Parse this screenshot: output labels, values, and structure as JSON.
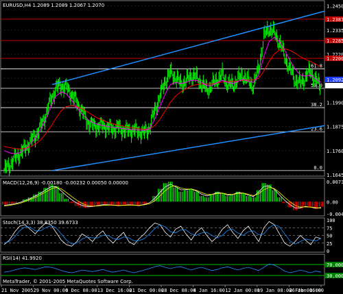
{
  "chart_data": {
    "type": "line",
    "main": {
      "title": "EURUSD,H4  1.2089 1.2089 1.2067 1.2070",
      "price_ticks": [
        "1.2450",
        "1.2335",
        "1.2220",
        "1.2105",
        "1.1990",
        "1.1875",
        "1.1760",
        "1.1645"
      ],
      "ylim": [
        1.1645,
        1.2465
      ],
      "last_price": "1.2070",
      "ask_tag": "1.2092",
      "fib_levels": [
        {
          "label": "0.0",
          "price": 1.1665
        },
        {
          "label": "23.6",
          "price": 1.185
        },
        {
          "label": "38.2",
          "price": 1.1965
        },
        {
          "label": "50.0",
          "price": 1.2057
        },
        {
          "label": "61.8",
          "price": 1.215
        }
      ],
      "red_lines": [
        1.22,
        1.2285,
        1.2387
      ],
      "price_series": [
        1.1665,
        1.169,
        1.172,
        1.1745,
        1.177,
        1.18,
        1.183,
        1.187,
        1.193,
        1.2,
        1.206,
        1.207,
        1.206,
        1.203,
        1.199,
        1.195,
        1.19,
        1.188,
        1.1875,
        1.188,
        1.187,
        1.1865,
        1.187,
        1.186,
        1.1855,
        1.186,
        1.185,
        1.1845,
        1.187,
        1.195,
        1.202,
        1.209,
        1.213,
        1.211,
        1.208,
        1.209,
        1.212,
        1.211,
        1.208,
        1.205,
        1.207,
        1.21,
        1.212,
        1.208,
        1.207,
        1.21,
        1.212,
        1.209,
        1.207,
        1.215,
        1.23,
        1.2345,
        1.232,
        1.228,
        1.221,
        1.215,
        1.21,
        1.208,
        1.211,
        1.214,
        1.209,
        1.207
      ],
      "ma_fast": [
        1.176,
        1.175,
        1.1745,
        1.175,
        1.1765,
        1.179,
        1.182,
        1.186,
        1.191,
        1.197,
        1.202,
        1.204,
        1.203,
        1.2,
        1.1965,
        1.1935,
        1.191,
        1.1895,
        1.1885,
        1.188,
        1.1875,
        1.187,
        1.1868,
        1.1865,
        1.1862,
        1.186,
        1.1858,
        1.1856,
        1.1865,
        1.191,
        1.197,
        1.203,
        1.2075,
        1.2085,
        1.208,
        1.2085,
        1.2095,
        1.2095,
        1.2085,
        1.207,
        1.207,
        1.2085,
        1.2095,
        1.2085,
        1.208,
        1.209,
        1.21,
        1.209,
        1.2085,
        1.212,
        1.221,
        1.228,
        1.23,
        1.228,
        1.224,
        1.219,
        1.215,
        1.212,
        1.2115,
        1.212,
        1.21,
        1.2085
      ],
      "ma_slow": [
        1.178,
        1.1775,
        1.177,
        1.1768,
        1.177,
        1.1778,
        1.179,
        1.181,
        1.184,
        1.1875,
        1.1915,
        1.195,
        1.197,
        1.1975,
        1.197,
        1.196,
        1.1945,
        1.193,
        1.1915,
        1.1905,
        1.1895,
        1.1888,
        1.1882,
        1.1876,
        1.1871,
        1.1868,
        1.1865,
        1.1862,
        1.1864,
        1.188,
        1.191,
        1.195,
        1.199,
        1.202,
        1.204,
        1.2055,
        1.2068,
        1.2075,
        1.2078,
        1.2078,
        1.2078,
        1.2082,
        1.2088,
        1.209,
        1.209,
        1.2092,
        1.2096,
        1.2097,
        1.2096,
        1.2105,
        1.214,
        1.2185,
        1.222,
        1.224,
        1.2245,
        1.2238,
        1.2225,
        1.2208,
        1.2195,
        1.2185,
        1.2172,
        1.216
      ]
    },
    "macd": {
      "title": "MACD(12,26,9) -0.00180 -0.00232 0.00050 0.00000",
      "ticks": [
        "0.00739",
        "0.00",
        "-0.00432"
      ],
      "ylim": [
        -0.0045,
        0.0075
      ],
      "histogram": [
        -0.001,
        -0.0008,
        -0.0005,
        0.0,
        0.0008,
        0.0015,
        0.0025,
        0.0035,
        0.0048,
        0.006,
        0.0055,
        0.003,
        0.001,
        -0.0005,
        -0.0015,
        -0.002,
        -0.0022,
        -0.0018,
        -0.0012,
        -0.0008,
        -0.001,
        -0.0012,
        -0.0015,
        -0.0012,
        -0.001,
        -0.0012,
        -0.0015,
        -0.0008,
        0.0,
        0.002,
        0.0045,
        0.0065,
        0.007,
        0.005,
        0.0035,
        0.004,
        0.0045,
        0.0035,
        0.002,
        0.0015,
        0.0025,
        0.0035,
        0.003,
        0.002,
        0.0025,
        0.0035,
        0.003,
        0.002,
        0.0015,
        0.004,
        0.0065,
        0.006,
        0.004,
        0.0015,
        -0.0005,
        -0.002,
        -0.003,
        -0.0025,
        -0.0015,
        -0.002,
        -0.0025,
        -0.0018
      ],
      "signal": [
        -0.0015,
        -0.0013,
        -0.001,
        -0.0006,
        0.0,
        0.0007,
        0.0015,
        0.0024,
        0.0034,
        0.0044,
        0.005,
        0.0045,
        0.0032,
        0.0018,
        0.0005,
        -0.0006,
        -0.0013,
        -0.0016,
        -0.0015,
        -0.0013,
        -0.0012,
        -0.0012,
        -0.0013,
        -0.0013,
        -0.0012,
        -0.0012,
        -0.0013,
        -0.0011,
        -0.0007,
        0.0003,
        0.002,
        0.0038,
        0.0052,
        0.0055,
        0.0048,
        0.0044,
        0.0044,
        0.004,
        0.0032,
        0.0025,
        0.0025,
        0.0029,
        0.003,
        0.0026,
        0.0025,
        0.0029,
        0.003,
        0.0026,
        0.0021,
        0.0028,
        0.0042,
        0.005,
        0.0046,
        0.0032,
        0.0015,
        0.0,
        -0.0013,
        -0.0019,
        -0.0018,
        -0.0019,
        -0.0021,
        -0.0023
      ]
    },
    "stoch": {
      "title": "Stoch(14,3,3) 38.8350 39.6733",
      "ticks": [
        "100",
        "75",
        "50",
        "25",
        "0"
      ],
      "ylim": [
        0,
        100
      ],
      "main": [
        20,
        35,
        60,
        80,
        85,
        70,
        55,
        75,
        90,
        85,
        60,
        35,
        20,
        15,
        30,
        55,
        45,
        30,
        50,
        65,
        40,
        25,
        45,
        60,
        30,
        20,
        40,
        55,
        75,
        90,
        85,
        60,
        45,
        70,
        80,
        55,
        35,
        60,
        75,
        50,
        30,
        45,
        70,
        85,
        60,
        40,
        65,
        80,
        55,
        30,
        75,
        95,
        85,
        55,
        25,
        15,
        30,
        50,
        35,
        20,
        45,
        39
      ],
      "signal": [
        25,
        30,
        45,
        65,
        78,
        77,
        65,
        65,
        75,
        82,
        75,
        55,
        35,
        22,
        25,
        38,
        45,
        42,
        42,
        50,
        50,
        40,
        37,
        45,
        42,
        32,
        33,
        40,
        55,
        72,
        85,
        78,
        62,
        58,
        68,
        68,
        55,
        50,
        58,
        60,
        50,
        42,
        50,
        66,
        70,
        58,
        50,
        62,
        65,
        52,
        55,
        75,
        85,
        78,
        55,
        32,
        22,
        30,
        38,
        35,
        32,
        40
      ]
    },
    "rsi": {
      "title": "RSI(14) 41.9920",
      "ticks": [
        "70.0000",
        "30.0000"
      ],
      "ylim": [
        0,
        100
      ],
      "values": [
        42,
        45,
        50,
        55,
        58,
        55,
        52,
        57,
        62,
        60,
        55,
        48,
        43,
        40,
        44,
        50,
        47,
        44,
        48,
        52,
        46,
        42,
        46,
        50,
        44,
        40,
        45,
        50,
        56,
        62,
        66,
        60,
        55,
        60,
        62,
        56,
        50,
        56,
        60,
        54,
        48,
        52,
        58,
        62,
        56,
        50,
        56,
        60,
        54,
        48,
        60,
        72,
        68,
        58,
        46,
        40,
        44,
        50,
        45,
        40,
        46,
        42
      ]
    },
    "x_ticks": [
      "21 Nov 2005",
      "29 Nov 00:00",
      "6 Dec 08:00",
      "13 Dec 16:00",
      "21 Dec 00:00",
      "28 Dec 08:00",
      "4 Jan 16:00",
      "12 Jan 00:00",
      "19 Jan 08:00",
      "26 Jan 16:00",
      "3 Feb 00:00"
    ],
    "copyright": "MetaTrader, © 2001-2005 MetaQuotes Software Corp.",
    "colors": {
      "bars": "#00ff00",
      "channel": "#1e90ff",
      "ma_fast": "#ff00ff",
      "ma_slow": "#ff0000",
      "fib": "#ffffff",
      "red_line": "#ff0000",
      "macd_hist_up": "#00ff00",
      "macd_hist_down": "#ff0000",
      "macd_signal": "#ffff00",
      "macd_line": "#ffffff",
      "stoch_main": "#ffffff",
      "stoch_signal": "#1e90ff",
      "rsi": "#1e90ff",
      "rsi_level": "#00ff00"
    }
  }
}
